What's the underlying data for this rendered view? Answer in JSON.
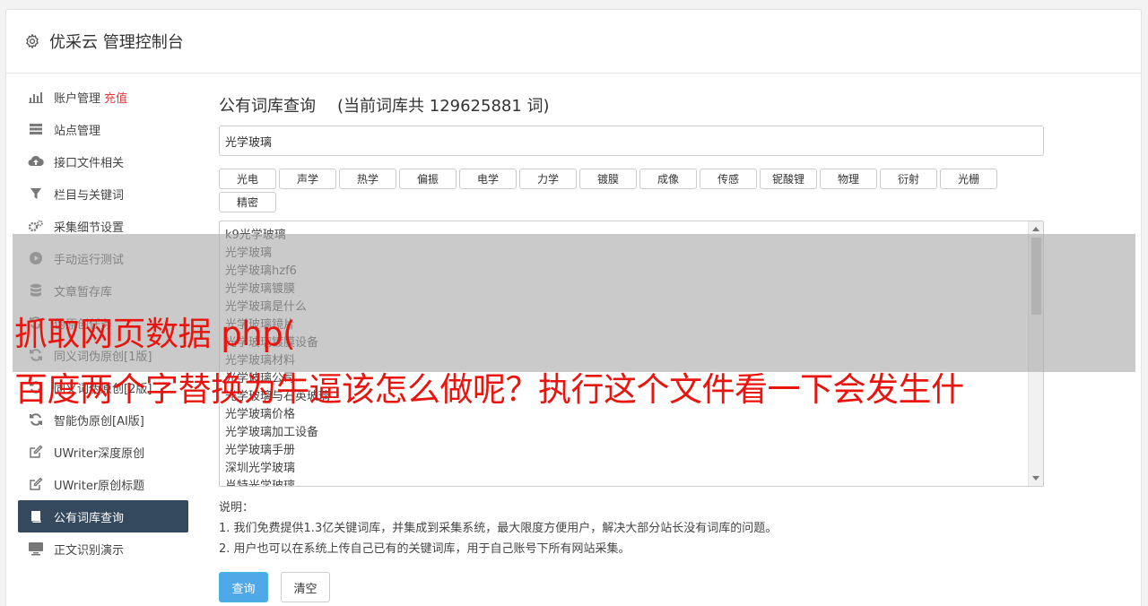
{
  "header": {
    "title": "优采云 管理控制台",
    "icon": "gear-icon"
  },
  "sidebar": {
    "items": [
      {
        "label": "账户管理",
        "badge": "充值",
        "icon": "bar-chart-icon"
      },
      {
        "label": "站点管理",
        "icon": "server-icon"
      },
      {
        "label": "接口文件相关",
        "icon": "cloud-upload-icon"
      },
      {
        "label": "栏目与关键词",
        "icon": "filter-icon"
      },
      {
        "label": "采集细节设置",
        "icon": "cogs-icon"
      },
      {
        "label": "手动运行测试",
        "icon": "play-circle-icon"
      },
      {
        "label": "文章暂存库",
        "icon": "database-icon"
      },
      {
        "label": "伪原创任务",
        "icon": "refresh-icon"
      },
      {
        "label": "同义词伪原创[1版]",
        "icon": "refresh-icon"
      },
      {
        "label": "同义词伪原创[2版]",
        "icon": "refresh-icon"
      },
      {
        "label": "智能伪原创[AI版]",
        "icon": "refresh-icon"
      },
      {
        "label": "UWriter深度原创",
        "icon": "edit-icon"
      },
      {
        "label": "UWriter原创标题",
        "icon": "edit-icon"
      },
      {
        "label": "公有词库查询",
        "icon": "book-icon",
        "active": true
      },
      {
        "label": "正文识别演示",
        "icon": "monitor-icon"
      }
    ]
  },
  "main": {
    "title": "公有词库查询",
    "count_text": "(当前词库共 129625881 词)",
    "search_value": "光学玻璃",
    "tags": [
      "光电",
      "声学",
      "热学",
      "偏振",
      "电学",
      "力学",
      "镀膜",
      "成像",
      "传感",
      "铌酸锂",
      "物理",
      "衍射",
      "光栅",
      "精密"
    ],
    "results": [
      "k9光学玻璃",
      "光学玻璃",
      "光学玻璃hzf6",
      "光学玻璃镀膜",
      "光学玻璃是什么",
      "光学玻璃镜片",
      "光学玻璃镀膜设备",
      "光学玻璃材料",
      "光学玻璃公司",
      "光学玻璃与石英玻璃",
      "光学玻璃价格",
      "光学玻璃加工设备",
      "光学玻璃手册",
      "深圳光学玻璃",
      "肖特光学玻璃"
    ],
    "notes_title": "说明：",
    "notes": [
      "1. 我们免费提供1.3亿关键词库，并集成到采集系统，最大限度方便用户，解决大部分站长没有词库的问题。",
      "2. 用户也可以在系统上传自己已有的关键词库，用于自己账号下所有网站采集。"
    ],
    "query_button": "查询",
    "clear_button": "清空"
  },
  "overlay": {
    "line1": "抓取网页数据 php(",
    "line2": "百度两个字替换为牛逼该怎么做呢？执行这个文件看一下会发生什"
  },
  "colors": {
    "active_nav": "#34495e",
    "badge": "#e4393c",
    "overlay_text": "#e8140d",
    "primary_button": "#4fa8e8"
  }
}
